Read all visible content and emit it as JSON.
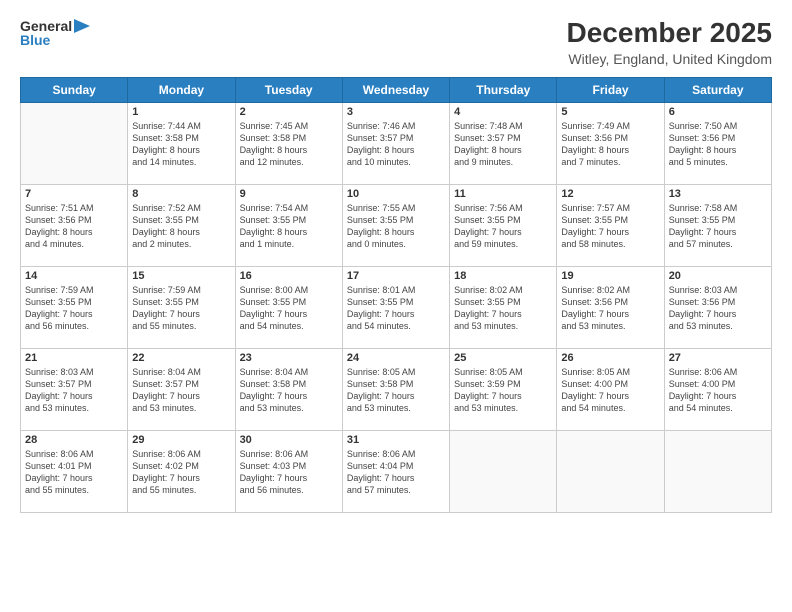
{
  "logo": {
    "general": "General",
    "blue": "Blue"
  },
  "header": {
    "title": "December 2025",
    "subtitle": "Witley, England, United Kingdom"
  },
  "weekdays": [
    "Sunday",
    "Monday",
    "Tuesday",
    "Wednesday",
    "Thursday",
    "Friday",
    "Saturday"
  ],
  "weeks": [
    [
      {
        "day": "",
        "info": ""
      },
      {
        "day": "1",
        "info": "Sunrise: 7:44 AM\nSunset: 3:58 PM\nDaylight: 8 hours\nand 14 minutes."
      },
      {
        "day": "2",
        "info": "Sunrise: 7:45 AM\nSunset: 3:58 PM\nDaylight: 8 hours\nand 12 minutes."
      },
      {
        "day": "3",
        "info": "Sunrise: 7:46 AM\nSunset: 3:57 PM\nDaylight: 8 hours\nand 10 minutes."
      },
      {
        "day": "4",
        "info": "Sunrise: 7:48 AM\nSunset: 3:57 PM\nDaylight: 8 hours\nand 9 minutes."
      },
      {
        "day": "5",
        "info": "Sunrise: 7:49 AM\nSunset: 3:56 PM\nDaylight: 8 hours\nand 7 minutes."
      },
      {
        "day": "6",
        "info": "Sunrise: 7:50 AM\nSunset: 3:56 PM\nDaylight: 8 hours\nand 5 minutes."
      }
    ],
    [
      {
        "day": "7",
        "info": "Sunrise: 7:51 AM\nSunset: 3:56 PM\nDaylight: 8 hours\nand 4 minutes."
      },
      {
        "day": "8",
        "info": "Sunrise: 7:52 AM\nSunset: 3:55 PM\nDaylight: 8 hours\nand 2 minutes."
      },
      {
        "day": "9",
        "info": "Sunrise: 7:54 AM\nSunset: 3:55 PM\nDaylight: 8 hours\nand 1 minute."
      },
      {
        "day": "10",
        "info": "Sunrise: 7:55 AM\nSunset: 3:55 PM\nDaylight: 8 hours\nand 0 minutes."
      },
      {
        "day": "11",
        "info": "Sunrise: 7:56 AM\nSunset: 3:55 PM\nDaylight: 7 hours\nand 59 minutes."
      },
      {
        "day": "12",
        "info": "Sunrise: 7:57 AM\nSunset: 3:55 PM\nDaylight: 7 hours\nand 58 minutes."
      },
      {
        "day": "13",
        "info": "Sunrise: 7:58 AM\nSunset: 3:55 PM\nDaylight: 7 hours\nand 57 minutes."
      }
    ],
    [
      {
        "day": "14",
        "info": "Sunrise: 7:59 AM\nSunset: 3:55 PM\nDaylight: 7 hours\nand 56 minutes."
      },
      {
        "day": "15",
        "info": "Sunrise: 7:59 AM\nSunset: 3:55 PM\nDaylight: 7 hours\nand 55 minutes."
      },
      {
        "day": "16",
        "info": "Sunrise: 8:00 AM\nSunset: 3:55 PM\nDaylight: 7 hours\nand 54 minutes."
      },
      {
        "day": "17",
        "info": "Sunrise: 8:01 AM\nSunset: 3:55 PM\nDaylight: 7 hours\nand 54 minutes."
      },
      {
        "day": "18",
        "info": "Sunrise: 8:02 AM\nSunset: 3:55 PM\nDaylight: 7 hours\nand 53 minutes."
      },
      {
        "day": "19",
        "info": "Sunrise: 8:02 AM\nSunset: 3:56 PM\nDaylight: 7 hours\nand 53 minutes."
      },
      {
        "day": "20",
        "info": "Sunrise: 8:03 AM\nSunset: 3:56 PM\nDaylight: 7 hours\nand 53 minutes."
      }
    ],
    [
      {
        "day": "21",
        "info": "Sunrise: 8:03 AM\nSunset: 3:57 PM\nDaylight: 7 hours\nand 53 minutes."
      },
      {
        "day": "22",
        "info": "Sunrise: 8:04 AM\nSunset: 3:57 PM\nDaylight: 7 hours\nand 53 minutes."
      },
      {
        "day": "23",
        "info": "Sunrise: 8:04 AM\nSunset: 3:58 PM\nDaylight: 7 hours\nand 53 minutes."
      },
      {
        "day": "24",
        "info": "Sunrise: 8:05 AM\nSunset: 3:58 PM\nDaylight: 7 hours\nand 53 minutes."
      },
      {
        "day": "25",
        "info": "Sunrise: 8:05 AM\nSunset: 3:59 PM\nDaylight: 7 hours\nand 53 minutes."
      },
      {
        "day": "26",
        "info": "Sunrise: 8:05 AM\nSunset: 4:00 PM\nDaylight: 7 hours\nand 54 minutes."
      },
      {
        "day": "27",
        "info": "Sunrise: 8:06 AM\nSunset: 4:00 PM\nDaylight: 7 hours\nand 54 minutes."
      }
    ],
    [
      {
        "day": "28",
        "info": "Sunrise: 8:06 AM\nSunset: 4:01 PM\nDaylight: 7 hours\nand 55 minutes."
      },
      {
        "day": "29",
        "info": "Sunrise: 8:06 AM\nSunset: 4:02 PM\nDaylight: 7 hours\nand 55 minutes."
      },
      {
        "day": "30",
        "info": "Sunrise: 8:06 AM\nSunset: 4:03 PM\nDaylight: 7 hours\nand 56 minutes."
      },
      {
        "day": "31",
        "info": "Sunrise: 8:06 AM\nSunset: 4:04 PM\nDaylight: 7 hours\nand 57 minutes."
      },
      {
        "day": "",
        "info": ""
      },
      {
        "day": "",
        "info": ""
      },
      {
        "day": "",
        "info": ""
      }
    ]
  ]
}
